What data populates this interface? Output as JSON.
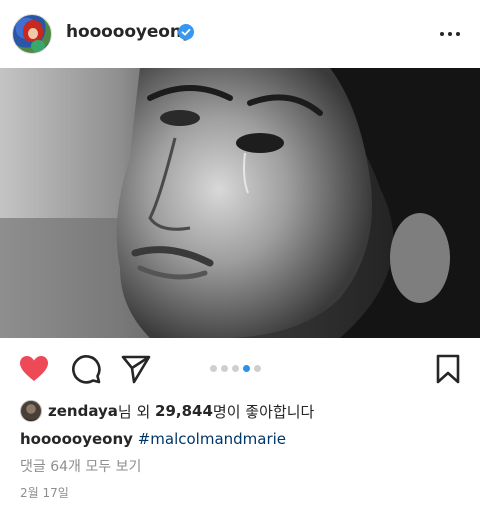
{
  "post": {
    "username": "hoooooyeony",
    "verified_icon": "verified-badge-icon",
    "more_icon": "more-options-icon",
    "carousel": {
      "count": 5,
      "active_index": 3
    },
    "actions": {
      "like_icon": "heart-filled-icon",
      "comment_icon": "comment-icon",
      "share_icon": "send-icon",
      "save_icon": "bookmark-icon"
    },
    "likes": {
      "liker": "zendaya",
      "connector": "님 외 ",
      "count": "29,844",
      "suffix": "명이 좋아합니다"
    },
    "caption": {
      "username": "hoooooyeony",
      "hashtag": "#malcolmandmarie"
    },
    "comments_link": "댓글 64개 모두 보기",
    "date": "2월 17일"
  },
  "colors": {
    "like_red": "#ed4956",
    "verified_blue": "#3897f0",
    "hashtag": "#00376b",
    "muted": "#8e8e8e",
    "active_dot": "#2f8fe8"
  }
}
